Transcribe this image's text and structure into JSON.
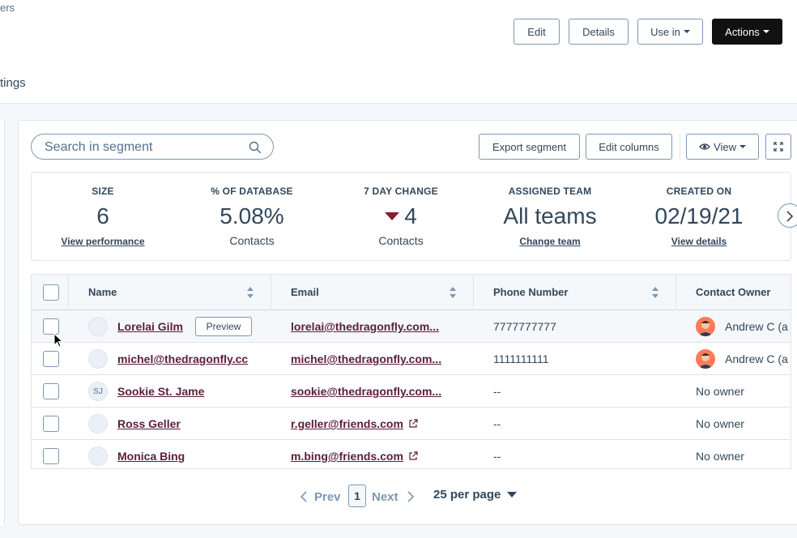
{
  "header": {
    "crumb_fragment": "ers",
    "tab_fragment": "tings",
    "buttons": {
      "edit": "Edit",
      "details": "Details",
      "use_in": "Use in",
      "actions": "Actions"
    }
  },
  "toolbar": {
    "search_placeholder": "Search in segment",
    "export": "Export segment",
    "edit_columns": "Edit columns",
    "view": "View"
  },
  "stats": [
    {
      "label": "SIZE",
      "value": "6",
      "sub": "View performance",
      "sub_is_link": true
    },
    {
      "label": "% OF DATABASE",
      "value": "5.08%",
      "sub": "Contacts",
      "sub_is_link": false
    },
    {
      "label": "7 DAY CHANGE",
      "value": "4",
      "sub": "Contacts",
      "sub_is_link": false,
      "trend": "down"
    },
    {
      "label": "ASSIGNED TEAM",
      "value": "All teams",
      "sub": "Change team",
      "sub_is_link": true
    },
    {
      "label": "CREATED ON",
      "value": "02/19/21",
      "sub": "View details",
      "sub_is_link": true
    }
  ],
  "table": {
    "columns": [
      "Name",
      "Email",
      "Phone Number",
      "Contact Owner"
    ],
    "preview_label": "Preview",
    "rows": [
      {
        "initials": "",
        "name": "Lorelai Gilm",
        "email": "lorelai@thedragonfly.com...",
        "phone": "7777777777",
        "owner": "Andrew C (a",
        "has_owner_avatar": true
      },
      {
        "initials": "",
        "name": "michel@thedragonfly.cc",
        "email": "michel@thedragonfly.com...",
        "phone": "1111111111",
        "owner": "Andrew C (a",
        "has_owner_avatar": true
      },
      {
        "initials": "SJ",
        "name": "Sookie St. Jame",
        "email": "sookie@thedragonfly.com...",
        "phone": "--",
        "owner": "No owner",
        "has_owner_avatar": false
      },
      {
        "initials": "",
        "name": "Ross Geller",
        "email": "r.geller@friends.com",
        "phone": "--",
        "owner": "No owner",
        "has_owner_avatar": false,
        "external": true
      },
      {
        "initials": "",
        "name": "Monica Bing",
        "email": "m.bing@friends.com",
        "phone": "--",
        "owner": "No owner",
        "has_owner_avatar": false,
        "external": true
      }
    ]
  },
  "pagination": {
    "prev": "Prev",
    "page": "1",
    "next": "Next",
    "per_page": "25 per page"
  },
  "colors": {
    "link": "#5a1f3a",
    "trend_down": "#8a1c2e",
    "primary_dark": "#111111",
    "border": "#7c98b6"
  }
}
